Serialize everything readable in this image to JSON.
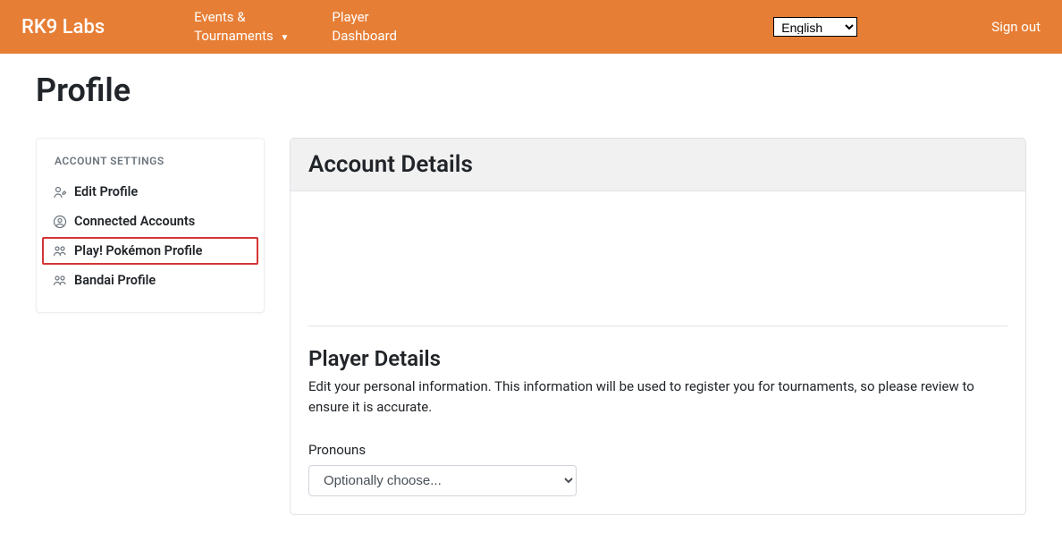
{
  "navbar": {
    "brand": "RK9 Labs",
    "events_label_line1": "Events &",
    "events_label_line2": "Tournaments",
    "dashboard_label_line1": "Player",
    "dashboard_label_line2": "Dashboard",
    "lang_selected": "English",
    "signout": "Sign out"
  },
  "page": {
    "title": "Profile"
  },
  "sidebar": {
    "heading": "ACCOUNT SETTINGS",
    "items": {
      "edit_profile": "Edit Profile",
      "connected_accounts": "Connected Accounts",
      "play_pokemon": "Play! Pokémon Profile",
      "bandai_profile": "Bandai Profile"
    }
  },
  "main": {
    "card_title": "Account Details",
    "player_details": {
      "title": "Player Details",
      "description": "Edit your personal information. This information will be used to register you for tournaments, so please review to ensure it is accurate.",
      "pronouns_label": "Pronouns",
      "pronouns_placeholder": "Optionally choose..."
    }
  }
}
